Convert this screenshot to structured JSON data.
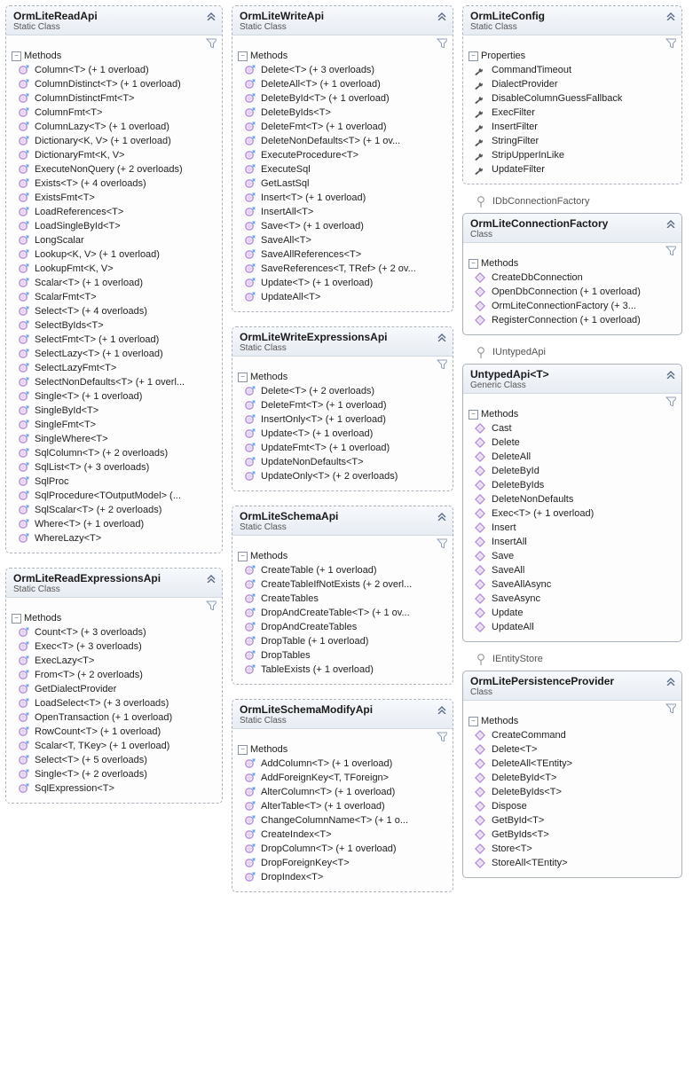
{
  "labels": {
    "methods": "Methods",
    "properties": "Properties",
    "staticClass": "Static Class",
    "class": "Class",
    "genericClass": "Generic Class"
  },
  "interfaces": {
    "idbConnectionFactory": "IDbConnectionFactory",
    "iUntypedApi": "IUntypedApi",
    "iEntityStore": "IEntityStore"
  },
  "panels": {
    "readApi": {
      "title": "OrmLiteReadApi",
      "subtitle": "staticClass",
      "section": "methods",
      "iconKind": "ext-method",
      "members": [
        "Column<T> (+ 1 overload)",
        "ColumnDistinct<T> (+ 1 overload)",
        "ColumnDistinctFmt<T>",
        "ColumnFmt<T>",
        "ColumnLazy<T> (+ 1 overload)",
        "Dictionary<K, V> (+ 1 overload)",
        "DictionaryFmt<K, V>",
        "ExecuteNonQuery (+ 2 overloads)",
        "Exists<T> (+ 4 overloads)",
        "ExistsFmt<T>",
        "LoadReferences<T>",
        "LoadSingleById<T>",
        "LongScalar",
        "Lookup<K, V> (+ 1 overload)",
        "LookupFmt<K, V>",
        "Scalar<T> (+ 1 overload)",
        "ScalarFmt<T>",
        "Select<T> (+ 4 overloads)",
        "SelectByIds<T>",
        "SelectFmt<T> (+ 1 overload)",
        "SelectLazy<T> (+ 1 overload)",
        "SelectLazyFmt<T>",
        "SelectNonDefaults<T> (+ 1 overl...",
        "Single<T> (+ 1 overload)",
        "SingleById<T>",
        "SingleFmt<T>",
        "SingleWhere<T>",
        "SqlColumn<T> (+ 2 overloads)",
        "SqlList<T> (+ 3 overloads)",
        "SqlProc",
        "SqlProcedure<TOutputModel>  (...",
        "SqlScalar<T> (+ 2 overloads)",
        "Where<T> (+ 1 overload)",
        "WhereLazy<T>"
      ]
    },
    "readExprApi": {
      "title": "OrmLiteReadExpressionsApi",
      "subtitle": "staticClass",
      "section": "methods",
      "iconKind": "ext-method",
      "members": [
        "Count<T> (+ 3 overloads)",
        "Exec<T> (+ 3 overloads)",
        "ExecLazy<T>",
        "From<T> (+ 2 overloads)",
        "GetDialectProvider",
        "LoadSelect<T> (+ 3 overloads)",
        "OpenTransaction (+ 1 overload)",
        "RowCount<T> (+ 1 overload)",
        "Scalar<T, TKey> (+ 1 overload)",
        "Select<T> (+ 5 overloads)",
        "Single<T> (+ 2 overloads)",
        "SqlExpression<T>"
      ]
    },
    "writeApi": {
      "title": "OrmLiteWriteApi",
      "subtitle": "staticClass",
      "section": "methods",
      "iconKind": "ext-method",
      "members": [
        "Delete<T> (+ 3 overloads)",
        "DeleteAll<T> (+ 1 overload)",
        "DeleteById<T> (+ 1 overload)",
        "DeleteByIds<T>",
        "DeleteFmt<T> (+ 1 overload)",
        "DeleteNonDefaults<T> (+ 1 ov...",
        "ExecuteProcedure<T>",
        "ExecuteSql",
        "GetLastSql",
        "Insert<T> (+ 1 overload)",
        "InsertAll<T>",
        "Save<T> (+ 1 overload)",
        "SaveAll<T>",
        "SaveAllReferences<T>",
        "SaveReferences<T, TRef> (+ 2 ov...",
        "Update<T> (+ 1 overload)",
        "UpdateAll<T>"
      ]
    },
    "writeExprApi": {
      "title": "OrmLiteWriteExpressionsApi",
      "subtitle": "staticClass",
      "section": "methods",
      "iconKind": "ext-method",
      "members": [
        "Delete<T> (+ 2 overloads)",
        "DeleteFmt<T> (+ 1 overload)",
        "InsertOnly<T> (+ 1 overload)",
        "Update<T> (+ 1 overload)",
        "UpdateFmt<T> (+ 1 overload)",
        "UpdateNonDefaults<T>",
        "UpdateOnly<T> (+ 2 overloads)"
      ]
    },
    "schemaApi": {
      "title": "OrmLiteSchemaApi",
      "subtitle": "staticClass",
      "section": "methods",
      "iconKind": "ext-method",
      "members": [
        "CreateTable (+ 1 overload)",
        "CreateTableIfNotExists (+ 2 overl...",
        "CreateTables",
        "DropAndCreateTable<T> (+ 1 ov...",
        "DropAndCreateTables",
        "DropTable (+ 1 overload)",
        "DropTables",
        "TableExists (+ 1 overload)"
      ]
    },
    "schemaModifyApi": {
      "title": "OrmLiteSchemaModifyApi",
      "subtitle": "staticClass",
      "section": "methods",
      "iconKind": "ext-method",
      "members": [
        "AddColumn<T> (+ 1 overload)",
        "AddForeignKey<T, TForeign>",
        "AlterColumn<T> (+ 1 overload)",
        "AlterTable<T> (+ 1 overload)",
        "ChangeColumnName<T> (+ 1 o...",
        "CreateIndex<T>",
        "DropColumn<T> (+ 1 overload)",
        "DropForeignKey<T>",
        "DropIndex<T>"
      ]
    },
    "config": {
      "title": "OrmLiteConfig",
      "subtitle": "staticClass",
      "section": "properties",
      "iconKind": "property",
      "members": [
        "CommandTimeout",
        "DialectProvider",
        "DisableColumnGuessFallback",
        "ExecFilter",
        "InsertFilter",
        "StringFilter",
        "StripUpperInLike",
        "UpdateFilter"
      ]
    },
    "connFactory": {
      "title": "OrmLiteConnectionFactory",
      "subtitle": "class",
      "section": "methods",
      "iconKind": "method",
      "members": [
        "CreateDbConnection",
        "OpenDbConnection (+ 1 overload)",
        "OrmLiteConnectionFactory (+ 3...",
        "RegisterConnection (+ 1 overload)"
      ]
    },
    "untypedApi": {
      "title": "UntypedApi<T>",
      "subtitle": "genericClass",
      "section": "methods",
      "iconKind": "method",
      "members": [
        "Cast",
        "Delete",
        "DeleteAll",
        "DeleteById",
        "DeleteByIds",
        "DeleteNonDefaults",
        "Exec<T> (+ 1 overload)",
        "Insert",
        "InsertAll",
        "Save",
        "SaveAll",
        "SaveAllAsync",
        "SaveAsync",
        "Update",
        "UpdateAll"
      ]
    },
    "persistenceProvider": {
      "title": "OrmLitePersistenceProvider",
      "subtitle": "class",
      "section": "methods",
      "iconKind": "method",
      "members": [
        "CreateCommand",
        "Delete<T>",
        "DeleteAll<TEntity>",
        "DeleteById<T>",
        "DeleteByIds<T>",
        "Dispose",
        "GetById<T>",
        "GetByIds<T>",
        "Store<T>",
        "StoreAll<TEntity>"
      ]
    }
  },
  "layout": {
    "col1": [
      "readApi",
      "readExprApi"
    ],
    "col2": [
      "writeApi",
      "writeExprApi",
      "schemaApi",
      "schemaModifyApi"
    ],
    "col3": [
      {
        "panel": "config"
      },
      {
        "interface": "idbConnectionFactory"
      },
      {
        "panel": "connFactory",
        "solid": true
      },
      {
        "interface": "iUntypedApi"
      },
      {
        "panel": "untypedApi",
        "solid": true
      },
      {
        "interface": "iEntityStore"
      },
      {
        "panel": "persistenceProvider",
        "solid": true
      }
    ]
  }
}
